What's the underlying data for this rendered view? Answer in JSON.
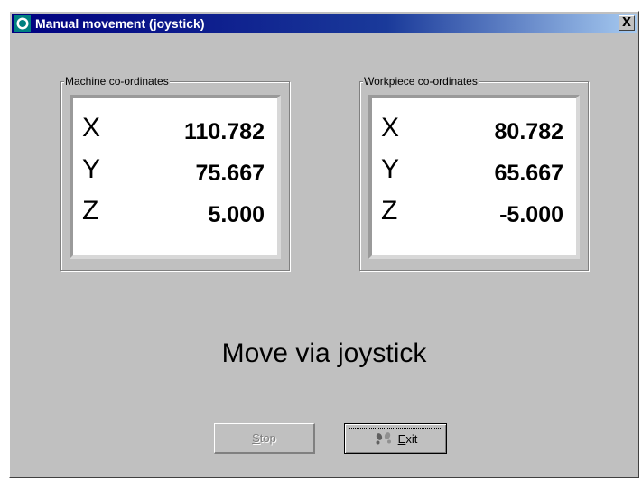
{
  "window": {
    "title": "Manual movement (joystick)",
    "close_label": "X"
  },
  "machine": {
    "label": "Machine co-ordinates",
    "coords": [
      {
        "axis": "X",
        "value": "110.782"
      },
      {
        "axis": "Y",
        "value": "75.667"
      },
      {
        "axis": "Z",
        "value": "5.000"
      }
    ]
  },
  "workpiece": {
    "label": "Workpiece co-ordinates",
    "coords": [
      {
        "axis": "X",
        "value": "80.782"
      },
      {
        "axis": "Y",
        "value": "65.667"
      },
      {
        "axis": "Z",
        "value": "-5.000"
      }
    ]
  },
  "status": {
    "text": "Move via joystick"
  },
  "buttons": {
    "stop": {
      "mnemonic": "S",
      "rest": "top",
      "enabled": false
    },
    "exit": {
      "mnemonic": "E",
      "rest": "xit",
      "enabled": true
    }
  },
  "colors": {
    "dialog_bg": "#c0c0c0",
    "title_bar_start": "#000080",
    "title_bar_end": "#a6caf0",
    "display_bg": "#ffffff",
    "disabled_text": "#808080"
  },
  "icons": {
    "title": "circle-app-icon",
    "exit": "exit-footprints-icon"
  }
}
